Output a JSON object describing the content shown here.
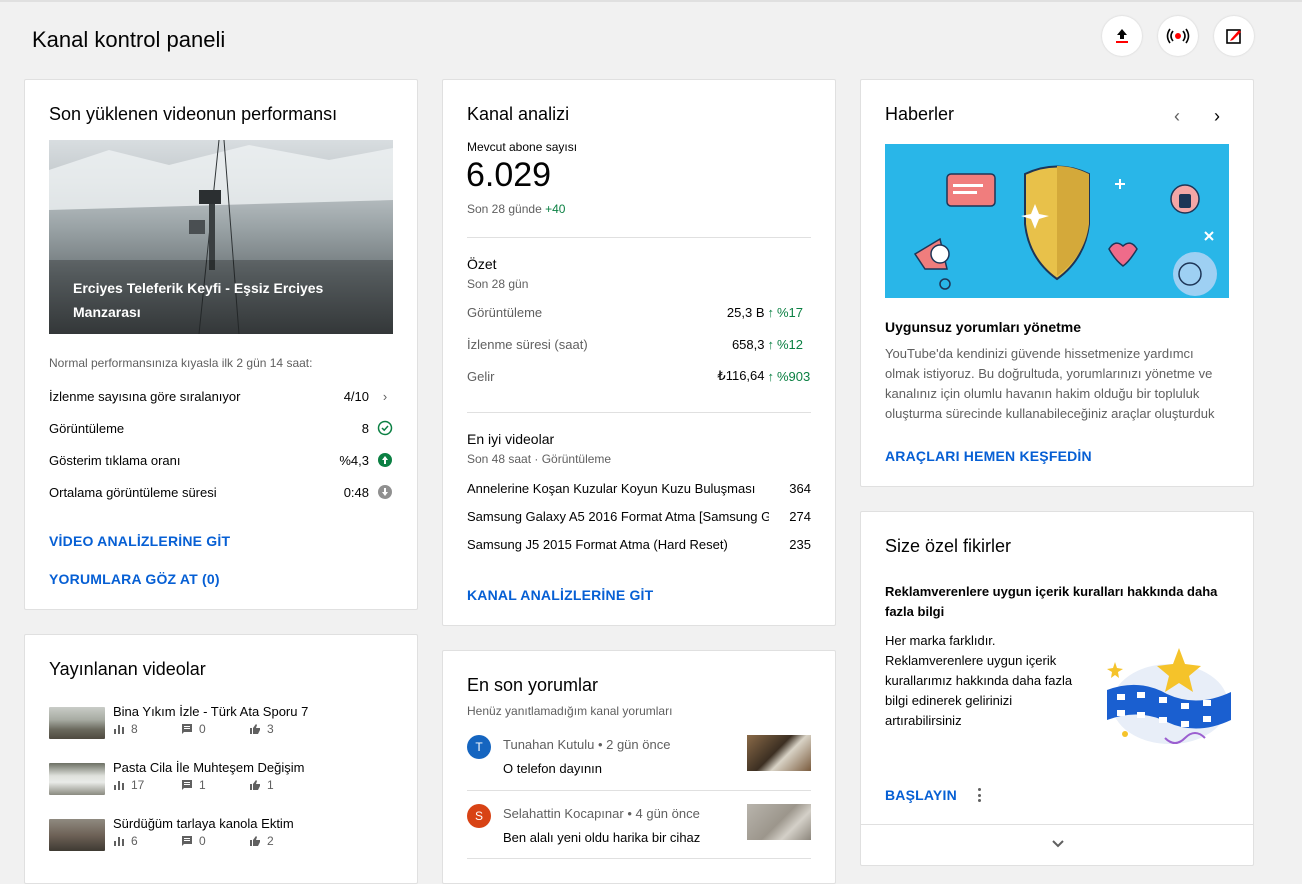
{
  "header": {
    "title": "Kanal kontrol paneli"
  },
  "perf": {
    "title": "Son yüklenen videonun performansı",
    "video_title": "Erciyes Teleferik Keyfi - Eşsiz Erciyes Manzarası",
    "intro": "Normal performansınıza kıyasla ilk 2 gün 14 saat:",
    "rows": [
      {
        "label": "İzlenme sayısına göre sıralanıyor",
        "value": "4/10"
      },
      {
        "label": "Görüntüleme",
        "value": "8"
      },
      {
        "label": "Gösterim tıklama oranı",
        "value": "%4,3"
      },
      {
        "label": "Ortalama görüntüleme süresi",
        "value": "0:48"
      }
    ],
    "link1": "VİDEO ANALİZLERİNE GİT",
    "link2": "YORUMLARA GÖZ AT (0)"
  },
  "published": {
    "title": "Yayınlanan videolar",
    "items": [
      {
        "title": "Bina Yıkım İzle - Türk Ata Sporu 7",
        "views": "8",
        "comments": "0",
        "likes": "3"
      },
      {
        "title": "Pasta Cila İle Muhteşem Değişim",
        "views": "17",
        "comments": "1",
        "likes": "1"
      },
      {
        "title": "Sürdüğüm tarlaya kanola Ektim",
        "views": "6",
        "comments": "0",
        "likes": "2"
      }
    ]
  },
  "analytics": {
    "title": "Kanal analizi",
    "subs_label": "Mevcut abone sayısı",
    "subs_value": "6.029",
    "subs_period": "Son 28 günde",
    "subs_delta": "+40",
    "summary_title": "Özet",
    "summary_period": "Son 28 gün",
    "summary": [
      {
        "label": "Görüntüleme",
        "value": "25,3 B",
        "pct": "%17"
      },
      {
        "label": "İzlenme süresi (saat)",
        "value": "658,3",
        "pct": "%12"
      },
      {
        "label": "Gelir",
        "value": "₺116,64",
        "pct": "%903"
      }
    ],
    "top_title": "En iyi videolar",
    "top_period": "Son 48 saat · Görüntüleme",
    "top": [
      {
        "title": "Annelerine Koşan Kuzular Koyun Kuzu Buluşması",
        "value": "364"
      },
      {
        "title": "Samsung Galaxy A5 2016 Format Atma [Samsung G...",
        "value": "274"
      },
      {
        "title": "Samsung J5 2015 Format Atma (Hard Reset)",
        "value": "235"
      }
    ],
    "link": "KANAL ANALİZLERİNE GİT"
  },
  "comments": {
    "title": "En son yorumlar",
    "subtitle": "Henüz yanıtlamadığım kanal yorumları",
    "items": [
      {
        "initial": "T",
        "color": "#1565c0",
        "author": "Tunahan Kutulu",
        "time": "• 2 gün önce",
        "text": "O telefon dayının"
      },
      {
        "initial": "S",
        "color": "#d84315",
        "author": "Selahattin Kocapınar",
        "time": "• 4 gün önce",
        "text": "Ben alalı yeni oldu harika bir cihaz"
      }
    ]
  },
  "news": {
    "title": "Haberler",
    "headline": "Uygunsuz yorumları yönetme",
    "body": "YouTube'da kendinizi güvende hissetmenize yardımcı olmak istiyoruz. Bu doğrultuda, yorumlarınızı yönetme ve kanalınız için olumlu havanın hakim olduğu bir topluluk oluşturma sürecinde kullanabileceğiniz araçlar oluşturduk",
    "link": "ARAÇLARI HEMEN KEŞFEDİN"
  },
  "ideas": {
    "title": "Size özel fikirler",
    "headline": "Reklamverenlere uygun içerik kuralları hakkında daha fazla bilgi",
    "body": "Her marka farklıdır. Reklamverenlere uygun içerik kurallarımız hakkında daha fazla bilgi edinerek gelirinizi artırabilirsiniz",
    "link": "BAŞLAYIN"
  },
  "colors": {
    "accent": "#065fd4",
    "positive": "#0b8043",
    "brand_red": "#ff0000"
  }
}
